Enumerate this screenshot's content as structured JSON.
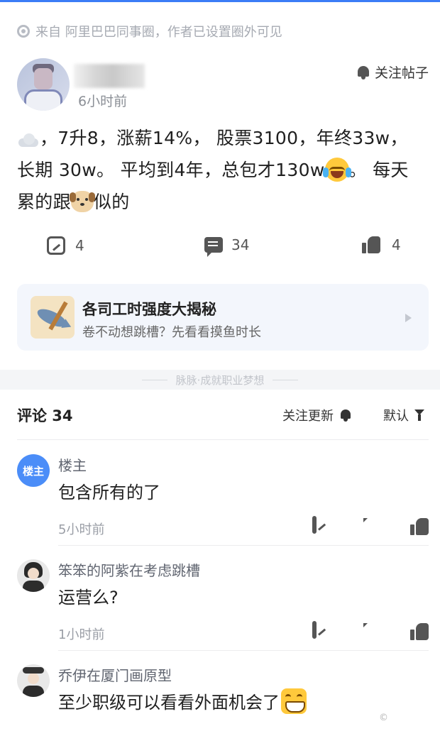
{
  "source": {
    "text": "来自 阿里巴巴同事圈，作者已设置圈外可见"
  },
  "post": {
    "time": "6小时前",
    "follow_label": "关注帖子",
    "text_1": "，7升8，涨薪14%， 股票3100，年终33w，长期 30w。 平均到4年，总包才130w",
    "text_2": "。 每天累的跟",
    "text_3": "似的",
    "share_count": "4",
    "comment_count": "34",
    "like_count": "4"
  },
  "topic": {
    "title": "各司工时强度大揭秘",
    "subtitle": "卷不动想跳槽？先看看摸鱼时长"
  },
  "divider": {
    "text": "脉脉·成就职业梦想"
  },
  "comments_header": {
    "title": "评论 34",
    "follow_label": "关注更新",
    "sort_label": "默认"
  },
  "comments": [
    {
      "avatar_text": "楼主",
      "name": "楼主",
      "text": "包含所有的了",
      "time": "5小时前"
    },
    {
      "name": "笨笨的阿紫在考虑跳槽",
      "text": "运营么?",
      "time": "1小时前"
    },
    {
      "name": "乔伊在厦门画原型",
      "text": "至少职级可以看看外面机会了"
    }
  ],
  "icons": {
    "source": "circle-dot-icon",
    "bell": "bell-icon",
    "share": "share-icon",
    "comment": "comment-icon",
    "like": "thumbs-up-icon",
    "filter": "filter-icon"
  },
  "colors": {
    "accent": "#3b7cf6",
    "host_badge": "#4b8df8",
    "card_bg": "#f3f6fc"
  }
}
